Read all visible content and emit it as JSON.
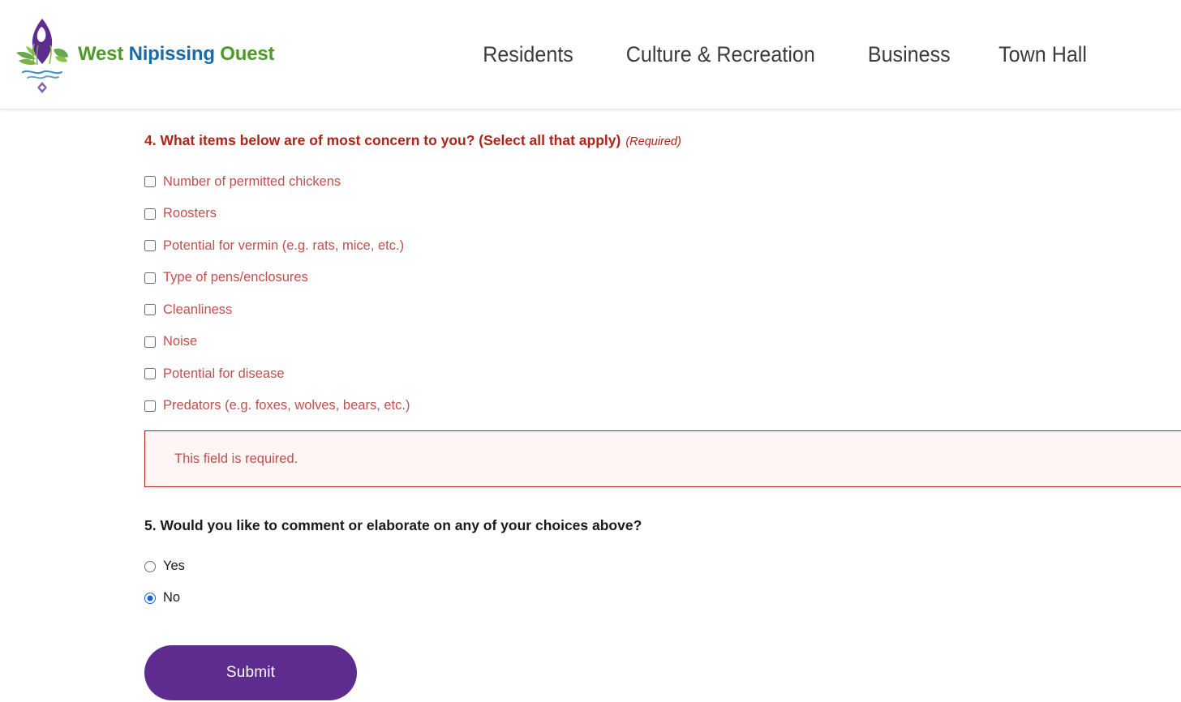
{
  "header": {
    "logo": {
      "icon_name": "west-nipissing-fleur-de-lis-logo",
      "word_part_1": "West ",
      "word_part_2": "Nipissing",
      "word_part_3": " Ouest",
      "colors": {
        "green": "#4c9a2a",
        "blue": "#1b6aa5",
        "purple": "#5e2c8f"
      }
    },
    "nav": [
      {
        "label": "Residents"
      },
      {
        "label": "Culture & Recreation"
      },
      {
        "label": "Business"
      },
      {
        "label": "Town Hall"
      }
    ]
  },
  "form": {
    "question4": {
      "heading": "4. What items below are of most concern to you? (Select all that apply)",
      "required_tag": "(Required)",
      "heading_color": "#b02318",
      "options": [
        {
          "label": "Number of permitted chickens",
          "checked": false
        },
        {
          "label": "Roosters",
          "checked": false
        },
        {
          "label": "Potential for vermin (e.g. rats, mice, etc.)",
          "checked": false
        },
        {
          "label": "Type of pens/enclosures",
          "checked": false
        },
        {
          "label": "Cleanliness",
          "checked": false
        },
        {
          "label": "Noise",
          "checked": false
        },
        {
          "label": "Potential for disease",
          "checked": false
        },
        {
          "label": "Predators (e.g. foxes, wolves, bears, etc.)",
          "checked": false
        }
      ],
      "error_message": "This field is required.",
      "error_border_color": "#b02318",
      "error_background_color": "#fdf6f5"
    },
    "question5": {
      "heading": "5. Would you like to comment or elaborate on any of your choices above?",
      "heading_color": "#1a1a1a",
      "options": [
        {
          "label": "Yes",
          "checked": false
        },
        {
          "label": "No",
          "checked": true
        }
      ],
      "selected_value": "No",
      "selected_color": "#1566d6"
    },
    "submit": {
      "label": "Submit",
      "background_color": "#5e2c8f",
      "text_color": "#ffffff"
    }
  }
}
